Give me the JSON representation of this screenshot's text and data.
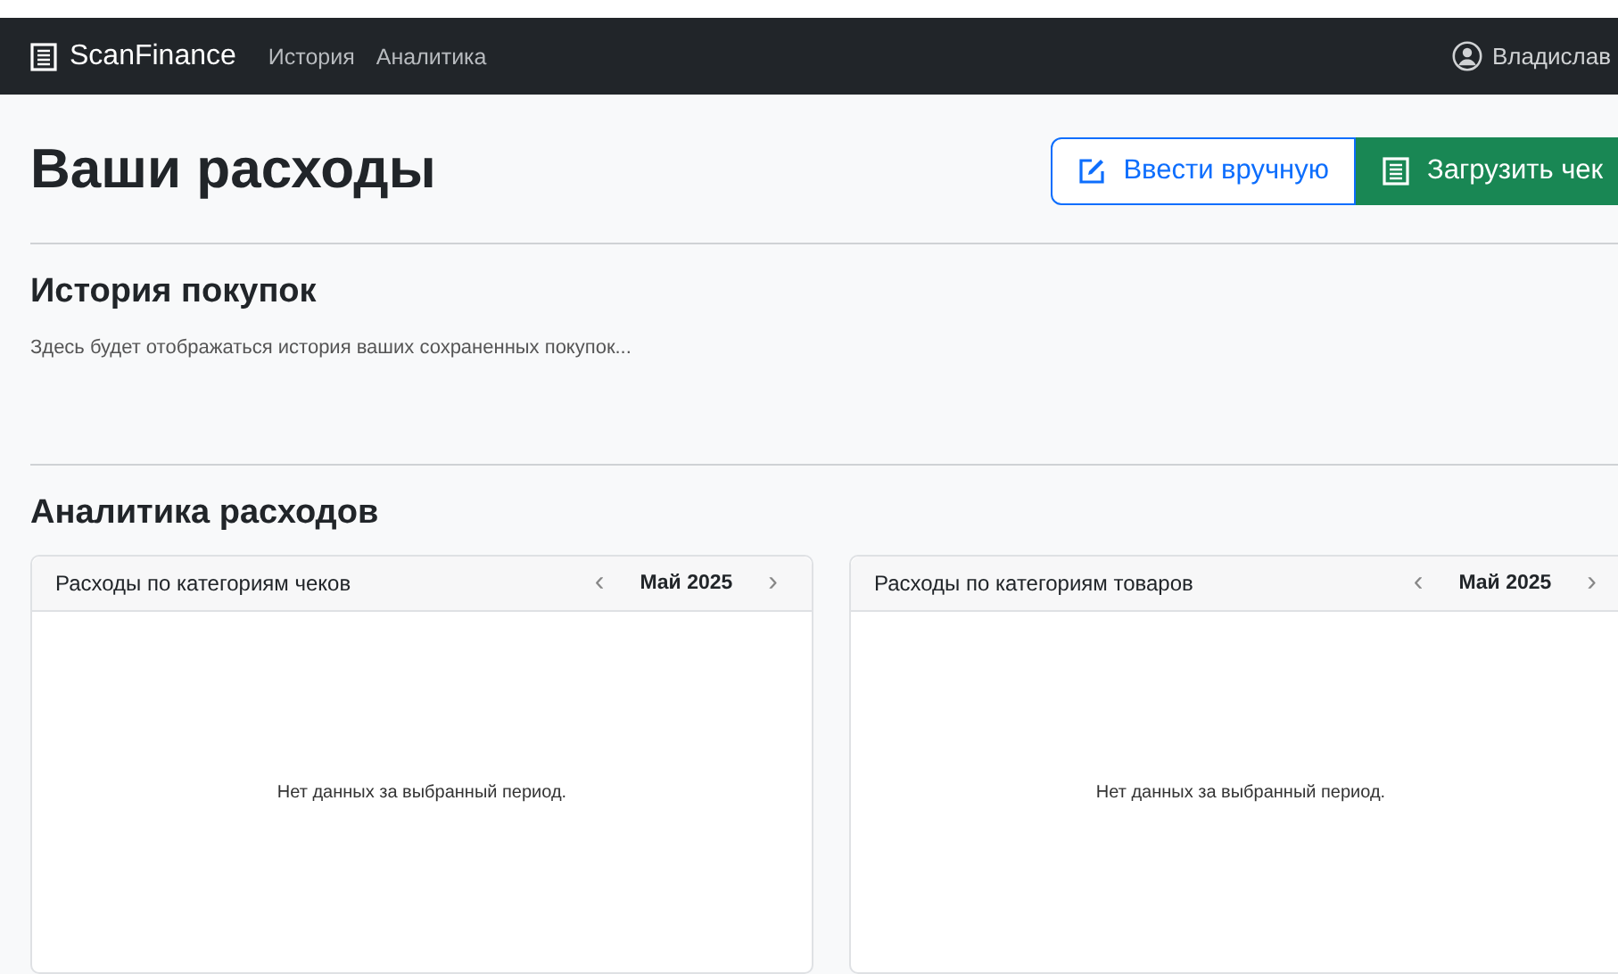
{
  "navbar": {
    "brand": "ScanFinance",
    "links": [
      {
        "label": "История"
      },
      {
        "label": "Аналитика"
      }
    ],
    "user": "Владислав"
  },
  "page": {
    "title": "Ваши расходы",
    "buttons": [
      {
        "label": "Ввести вручную",
        "kind": "outline"
      },
      {
        "label": "Загрузить чек",
        "kind": "primary"
      }
    ]
  },
  "history": {
    "title": "История покупок",
    "text": "Здесь будет отображаться история ваших сохраненных покупок..."
  },
  "analytics": {
    "title": "Аналитика расходов",
    "cards": [
      {
        "title": "Расходы по категориям чеков",
        "prev": "‹",
        "period": "Май 2025",
        "next": "›",
        "empty": "Нет данных за выбранный период."
      },
      {
        "title": "Расходы по категориям товаров",
        "prev": "‹",
        "period": "Май 2025",
        "next": "›",
        "empty": "Нет данных за выбранный период."
      }
    ]
  }
}
